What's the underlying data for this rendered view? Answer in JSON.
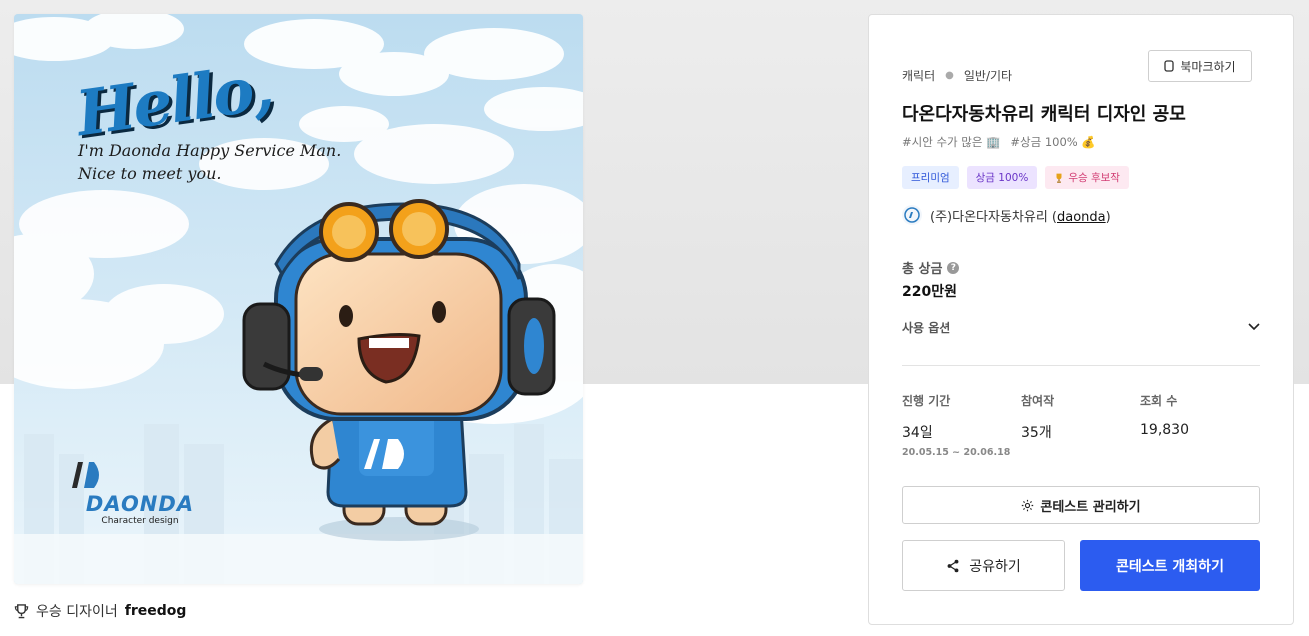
{
  "hero": {
    "hello": "Hello,",
    "line1": "I'm Daonda Happy Service Man.",
    "line2": "Nice to meet you.",
    "brand_name": "DAONDA",
    "brand_sub": "Character design"
  },
  "winner": {
    "prefix": "우승 디자이너",
    "name": "freedog"
  },
  "panel": {
    "category": "캐릭터",
    "subcategory": "일반/기타",
    "bookmark_label": "북마크하기",
    "title": "다온다자동차유리 캐릭터 디자인 공모",
    "tag1": "#시안 수가 많은 🏢",
    "tag2": "#상금 100% 💰",
    "badges": [
      "프리미엄",
      "상금 100%",
      "우승 후보작"
    ],
    "host_name": "(주)다온다자동차유리 (",
    "host_id": "daonda",
    "host_close": ")",
    "total_prize_label": "총 상금",
    "total_prize_value": "220만원",
    "usage_label": "사용 옵션",
    "stats": {
      "period_label": "진행 기간",
      "period_value": "34일",
      "period_range": "20.05.15 ~ 20.06.18",
      "entries_label": "참여작",
      "entries_value": "35개",
      "views_label": "조회 수",
      "views_value": "19,830"
    },
    "manage_label": "콘테스트 관리하기",
    "share_label": "공유하기",
    "host_contest_label": "콘테스트 개최하기"
  },
  "colors": {
    "primary": "#2c5cf0",
    "sky": "#cfe6f4",
    "character_blue": "#2f86d1"
  }
}
